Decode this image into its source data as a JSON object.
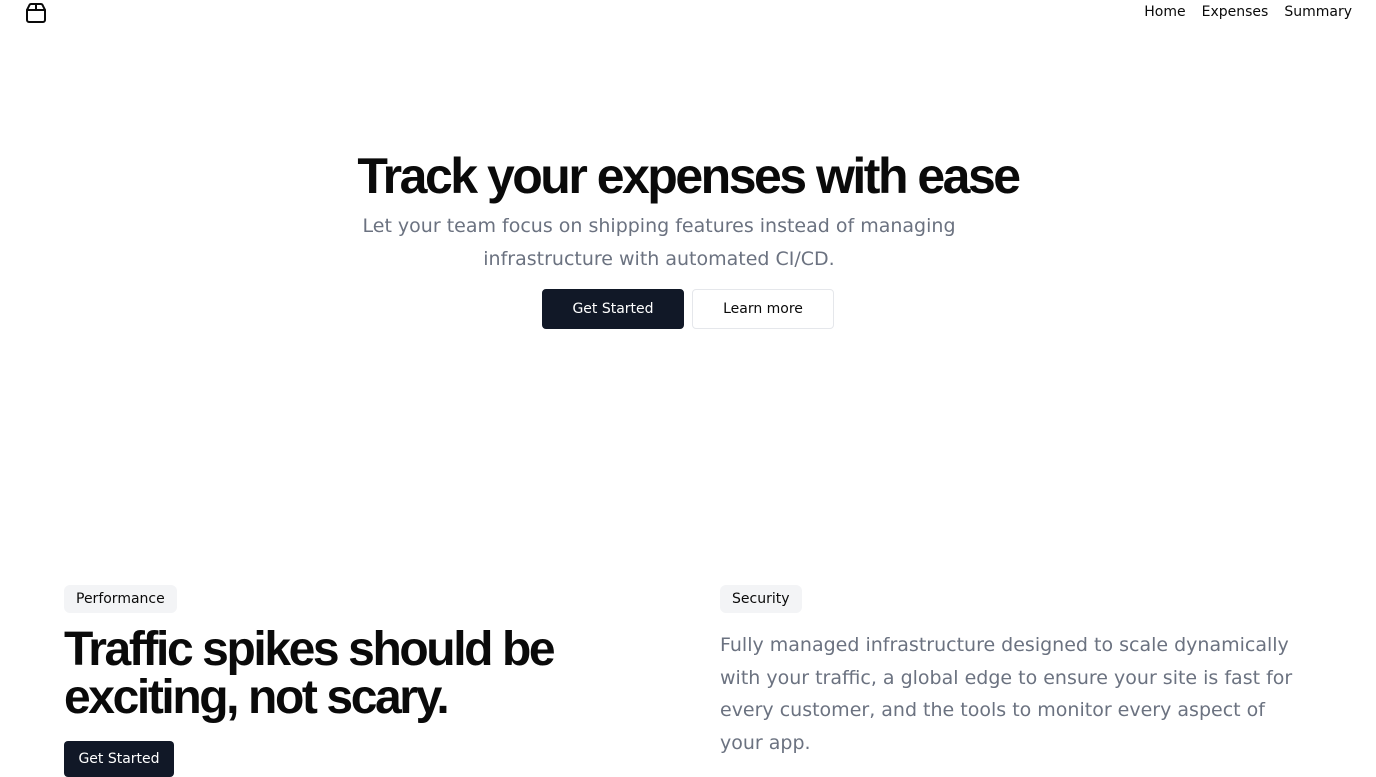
{
  "nav": {
    "logo_icon": "package-box-icon",
    "links": [
      "Home",
      "Expenses",
      "Summary"
    ]
  },
  "hero": {
    "title": "Track your expenses with ease",
    "subtitle": "Let your team focus on shipping features instead of managing infrastructure with automated CI/CD.",
    "primary_button": "Get Started",
    "secondary_button": "Learn more"
  },
  "features": {
    "left": {
      "badge": "Performance",
      "heading": "Traffic spikes should be exciting, not scary.",
      "button": "Get Started"
    },
    "right": {
      "badge": "Security",
      "text": "Fully managed infrastructure designed to scale dynamically with your traffic, a global edge to ensure your site is fast for every customer, and the tools to monitor every aspect of your app."
    }
  },
  "colors": {
    "primary": "#111827",
    "text": "#0a0a0a",
    "muted": "#6b7280",
    "badge_bg": "#f3f4f6",
    "border": "#e5e7eb"
  }
}
